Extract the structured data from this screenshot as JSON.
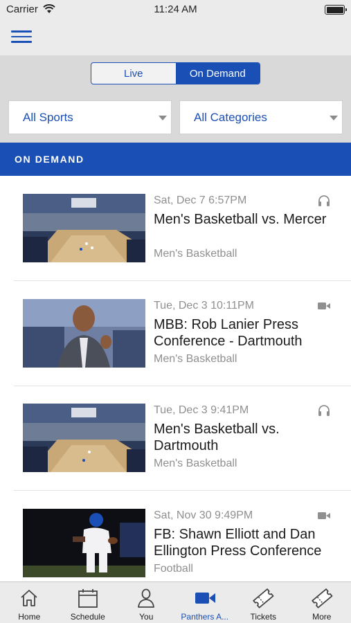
{
  "status_bar": {
    "carrier": "Carrier",
    "time": "11:24 AM"
  },
  "segmented": {
    "options": [
      "Live",
      "On Demand"
    ],
    "selected": "On Demand"
  },
  "filters": {
    "sports": "All Sports",
    "categories": "All Categories"
  },
  "section_header": "ON DEMAND",
  "items": [
    {
      "date": "Sat, Dec 7 6:57PM",
      "title": "Men's Basketball vs. Mercer",
      "category": "Men's Basketball",
      "media": "headphones-icon",
      "thumb": "arena"
    },
    {
      "date": "Tue, Dec 3 10:11PM",
      "title": "MBB: Rob Lanier Press Conference - Dartmouth",
      "category": "Men's Basketball",
      "media": "video-camera-icon",
      "thumb": "coach"
    },
    {
      "date": "Tue, Dec 3 9:41PM",
      "title": "Men's Basketball vs. Dartmouth",
      "category": "Men's Basketball",
      "media": "headphones-icon",
      "thumb": "arena"
    },
    {
      "date": "Sat, Nov 30 9:49PM",
      "title": "FB: Shawn Elliott and Dan Ellington Press Conference",
      "category": "Football",
      "media": "video-camera-icon",
      "thumb": "football"
    }
  ],
  "tabs": [
    {
      "label": "Home",
      "icon": "home-icon"
    },
    {
      "label": "Schedule",
      "icon": "calendar-icon"
    },
    {
      "label": "You",
      "icon": "person-icon"
    },
    {
      "label": "Panthers A...",
      "icon": "video-camera-icon",
      "active": true
    },
    {
      "label": "Tickets",
      "icon": "ticket-icon"
    },
    {
      "label": "More",
      "icon": "ticket-icon"
    }
  ],
  "colors": {
    "accent": "#1a4fb6",
    "bar_background": "#ebebeb",
    "controls_background": "#d9d9d9"
  }
}
